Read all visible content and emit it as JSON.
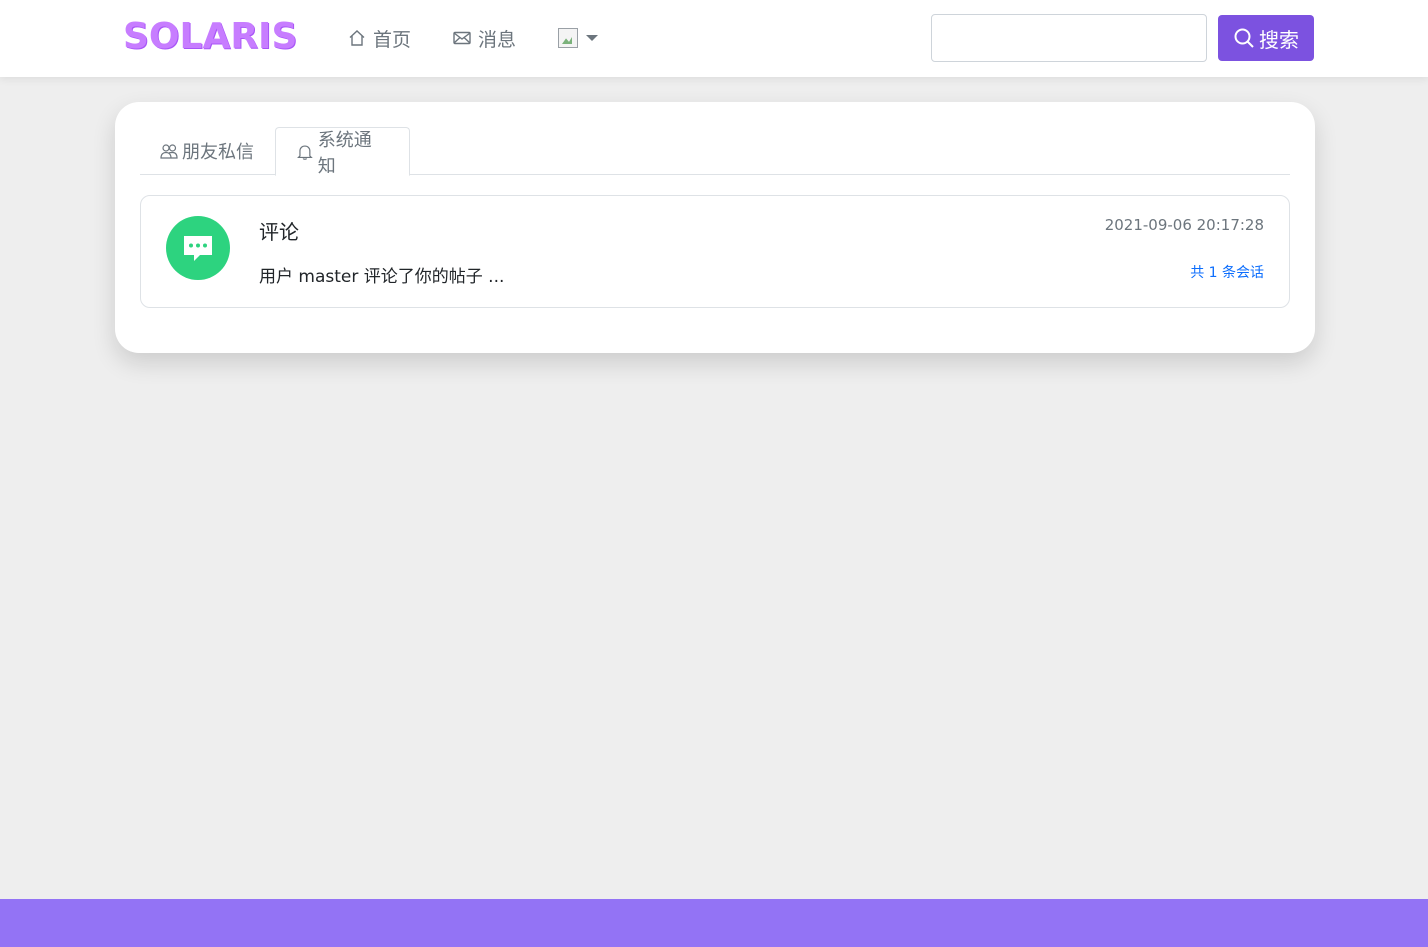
{
  "navbar": {
    "logo": "SOLARIS",
    "home_label": "首页",
    "messages_label": "消息",
    "search_placeholder": "",
    "search_button": "搜索"
  },
  "tabs": [
    {
      "label": "朋友私信",
      "icon": "people-icon",
      "active": false
    },
    {
      "label": "系统通知",
      "icon": "bell-icon",
      "active": true
    }
  ],
  "notices": [
    {
      "title": "评论",
      "time": "2021-09-06 20:17:28",
      "body": "用户 master 评论了你的帖子 ...",
      "count": "共 1 条会话",
      "icon": "comment-icon"
    }
  ],
  "colors": {
    "accent": "#7c52e0",
    "logo": "#c77dff",
    "footer": "#9373f5",
    "notice_icon_bg": "#2dd37f",
    "link": "#0d6efd"
  }
}
